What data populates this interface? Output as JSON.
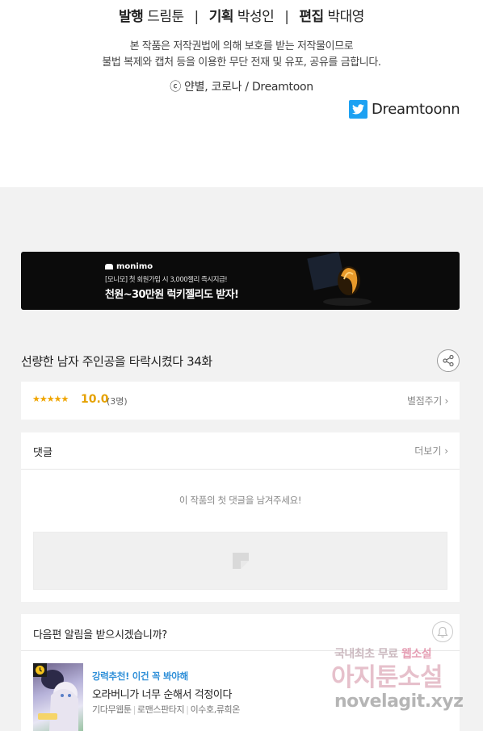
{
  "credits": {
    "publisher_label": "발행",
    "publisher_value": "드림툰",
    "planning_label": "기획",
    "planning_value": "박성인",
    "editing_label": "편집",
    "editing_value": "박대영",
    "separator": "|",
    "notice_line1": "본 작품은 저작권법에 의해 보호를 받는 저작물이므로",
    "notice_line2": "불법 복제와 캡처 등을 이용한 무단 전재 및 유포, 공유를 금합니다.",
    "copyright": "ⓒ 얀별, 코로나 / Dreamtoon",
    "twitter_handle": "Dreamtoonn"
  },
  "banner": {
    "brand": "monimo",
    "sub_text": "[모니모] 첫 회원가입 시 3,000젤리 즉시지급!",
    "main_text": "천원~30만원 럭키젤리도 받자!"
  },
  "episode": {
    "title": "선량한 남자 주인공을 타락시켰다 34화"
  },
  "rating": {
    "stars": "★★★★★",
    "score": "10.0",
    "count": "(3명)",
    "rate_link": "별점주기 ›"
  },
  "comments": {
    "header": "댓글",
    "more_link": "더보기 ›",
    "empty_message": "이 작품의 첫 댓글을 남겨주세요!"
  },
  "notify": {
    "question": "다음편 알림을 받으시겠습니까?"
  },
  "recommendation": {
    "tag": "강력추천! 이건 꼭 봐야해",
    "title": "오라버니가 너무 순해서 걱정이다",
    "meta_type": "기다무웹툰",
    "meta_genre": "로맨스판타지",
    "meta_authors": "이수호,류희온"
  },
  "watermark": {
    "line1_a": "국내최초 무료",
    "line1_b": "웹소설",
    "line2": "아지툰소설",
    "line3": "novelagit.xyz"
  },
  "colors": {
    "accent_blue": "#2f8fd8",
    "star_yellow": "#f0a500",
    "twitter_blue": "#1da1f2",
    "banner_bg": "#0b0b0b"
  },
  "icons": [
    "twitter-icon",
    "share-icon",
    "bell-icon",
    "clock-icon",
    "image-placeholder-icon"
  ]
}
